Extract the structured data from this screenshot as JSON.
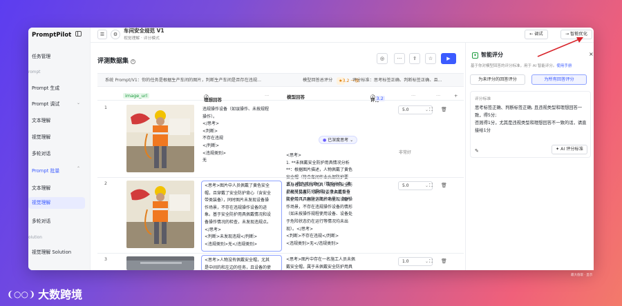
{
  "sidebar": {
    "brand": "PromptPilot",
    "items": [
      {
        "label": "任务管理"
      },
      {
        "label": "rompt"
      },
      {
        "label": "Prompt 生成"
      },
      {
        "label": "Prompt 调试"
      },
      {
        "label": "文本理解"
      },
      {
        "label": "视觉理解"
      },
      {
        "label": "多轮对话"
      },
      {
        "label": "Prompt 批量"
      },
      {
        "label": "文本理解"
      },
      {
        "label": "视觉理解"
      },
      {
        "label": "多轮对话"
      },
      {
        "label": "olution"
      },
      {
        "label": "视觉理解 Solution"
      }
    ]
  },
  "header": {
    "title": "车间安全规范 V1",
    "subtitle": "视觉理解 · 评分模式",
    "debug_label": "← 调试",
    "optimize_label": "→ 智能优化"
  },
  "main": {
    "title": "评测数据集",
    "system_prompt_label": "系统 Prompt/V1：你的任务是根据生产车间的图片，判断生产车间是否存在违规...",
    "avg_score_label": "模型回答总评分",
    "avg_score": "3.2 一般",
    "criteria_label": "评分标准：思考标签正确、判断标签正确、且...",
    "columns": {
      "image": "image_url",
      "ideal": "理想回答",
      "model": "模型回答",
      "score": "评分",
      "score_avg": "3.2"
    },
    "rows": [
      {
        "num": "1",
        "ideal": "违规操作设备（如误操作、未按规程\n操作）。\n</思考>\n<判断>\n不存在违规\n</判断>\n<违规类别>\n无",
        "model_tag": "已深度思考",
        "model": "<思考>\n1. **未佩戴安全防护用具情况分析\n**：根据图片描述，人物佩戴了黄色\n安全帽（符合车间作业头部防护要\n求），橙色反光背心（带反光条，满\n足高可见度防护需求），身上还系有\n安全带（具备坠落防护功能），图片",
        "score": "5.0",
        "hint": "非常好"
      },
      {
        "num": "2",
        "ideal": "<思考>图片中人员佩戴了黄色安全\n帽，且穿戴了安全防护背心（含安全\n带类装备），同时图片未发现设备操\n作场景，不存在违规操作设备的迹\n象。基于安全防护用具佩戴情况和设\n备操作情况的检查，未发现违规点。\n</思考>\n<判断>未发现违规</判断>\n<违规类别>无</违规类别>",
        "model": "且身着安全防护用具（配备有安全防\n护相关装备），属于按要求佩戴安全\n防护用具。同时，图片未呈现设备操\n作场景，不存在违规操作设备的情形\n（如未按操作规程使用设备、设备处\n于危险状态仍在运行等情况均未出\n现）。</思考>\n<判断>不存在违规</判断>\n<违规类别>无</违规类别>",
        "score": "5.0"
      },
      {
        "num": "3",
        "ideal": "<思考>人物没有佩戴安全帽，尤其\n是中间的和左边的任务，且设备的使",
        "model": "<思考>图片中存在一名施工人员未佩\n戴安全帽，属于未佩戴安全防护用具",
        "score": "1.0"
      }
    ]
  },
  "panel": {
    "title": "智能评分",
    "subtitle": "基于你对模型回答的评分标准，用于 AI 智能评分。",
    "manual_link": "使用手册",
    "tab_unscored": "为未评分的回答评分",
    "tab_all": "为所有回答评分",
    "criteria_label": "评分标准",
    "criteria_text": "思考标签正确、判断标签正确, 且违规类型和理想回答一致，得5分;\n否则得1分，尤其是违规类型和理想回答不一致的话，请直接给1分",
    "ai_button": "AI 评分标准"
  },
  "footer": {
    "logo_text": "大数跨境",
    "corner_text": "最大值取 · 显示"
  },
  "colors": {
    "accent": "#3b5bff",
    "green": "#1a9a3c",
    "arrow": "#d8232a"
  }
}
